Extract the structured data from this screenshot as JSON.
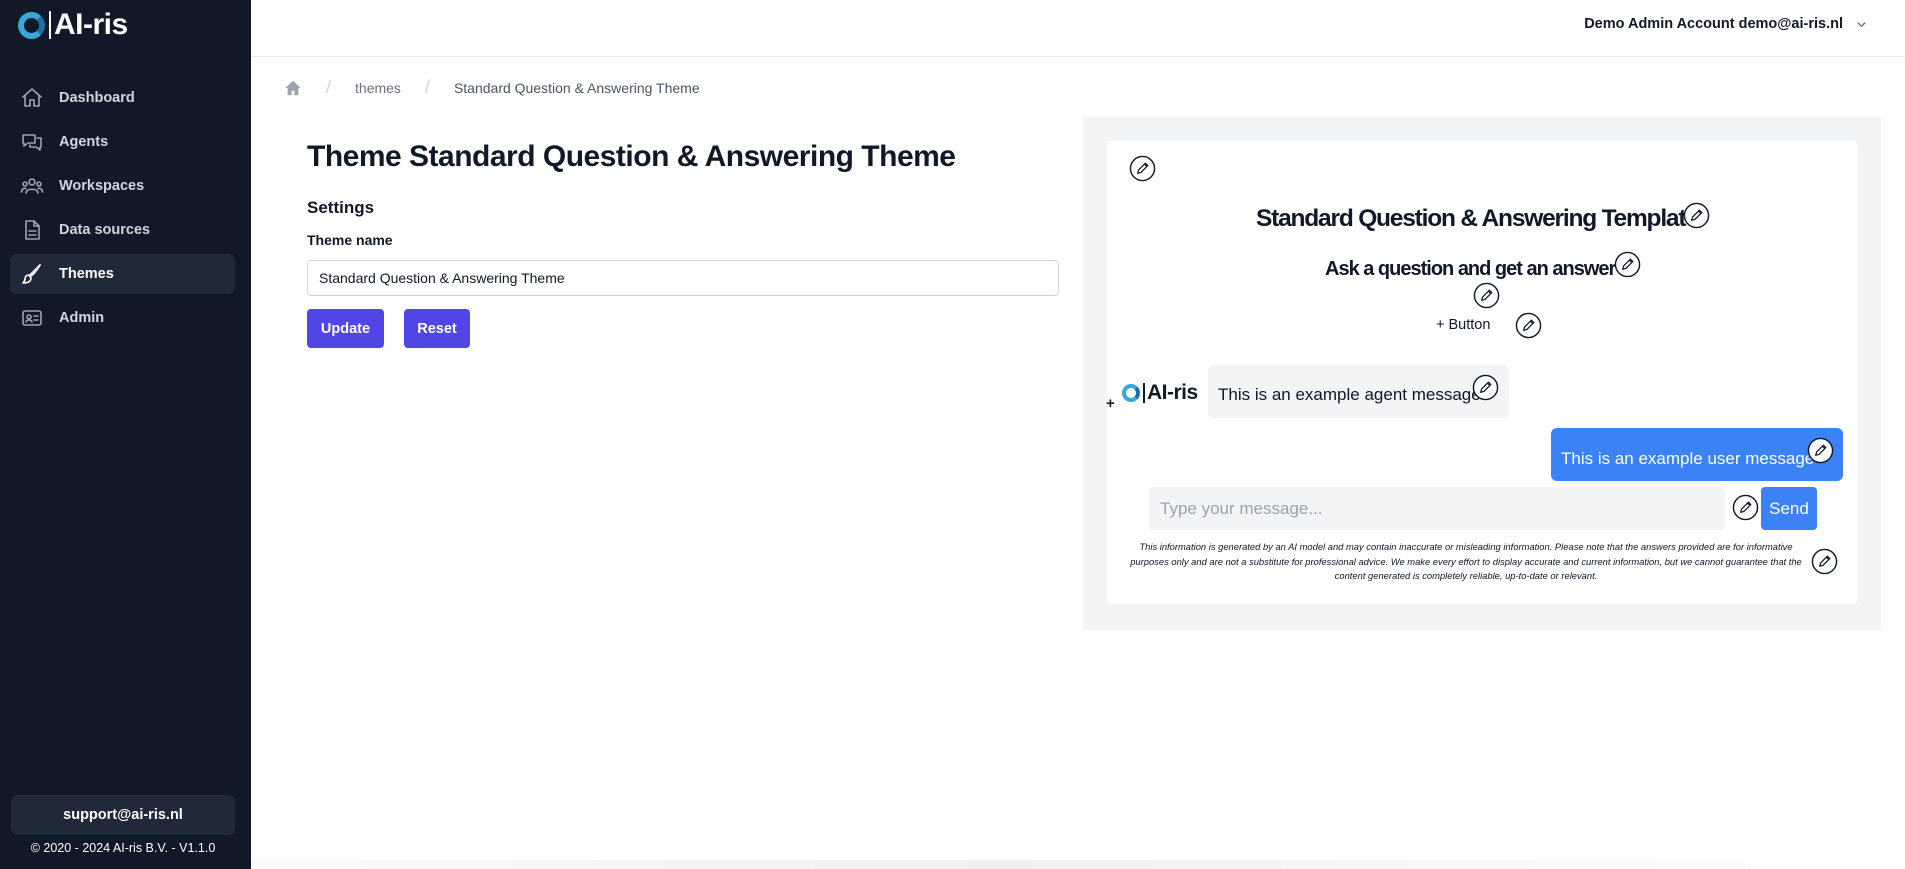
{
  "app": {
    "logo_text": "AI-ris"
  },
  "sidebar": {
    "items": [
      {
        "label": "Dashboard",
        "icon": "home-icon",
        "active": false
      },
      {
        "label": "Agents",
        "icon": "chat-bubbles-icon",
        "active": false
      },
      {
        "label": "Workspaces",
        "icon": "users-icon",
        "active": false
      },
      {
        "label": "Data sources",
        "icon": "document-icon",
        "active": false
      },
      {
        "label": "Themes",
        "icon": "paintbrush-icon",
        "active": true
      },
      {
        "label": "Admin",
        "icon": "id-card-icon",
        "active": false
      }
    ],
    "support_email": "support@ai-ris.nl",
    "copyright": "© 2020 - 2024 AI-ris B.V. - V1.1.0"
  },
  "topbar": {
    "account": "Demo Admin Account demo@ai-ris.nl"
  },
  "breadcrumb": {
    "items": [
      "themes",
      "Standard Question & Answering Theme"
    ]
  },
  "main": {
    "title": "Theme Standard Question & Answering Theme",
    "settings_heading": "Settings",
    "theme_name_label": "Theme name",
    "theme_name_value": "Standard Question & Answering Theme",
    "update_label": "Update",
    "reset_label": "Reset"
  },
  "preview": {
    "title": "Standard Question & Answering Template",
    "subtitle": "Ask a question and get an answer",
    "add_button_label": "+ Button",
    "add_symbol": "+",
    "agent_logo_text": "AI-ris",
    "agent_message": "This is an example agent message",
    "user_message": "This is an example user message",
    "input_placeholder": "Type your message...",
    "send_label": "Send",
    "disclaimer": "This information is generated by an AI model and may contain inaccurate or misleading information. Please note that the answers provided are for informative purposes only and are not a substitute for professional advice. We make every effort to display accurate and current information, but we cannot guarantee that the content generated is completely reliable, up-to-date or relevant.",
    "colors": {
      "user_bubble": "#3b82f6",
      "agent_bubble": "#f3f4f6",
      "primary_button": "#4f46e5"
    }
  }
}
